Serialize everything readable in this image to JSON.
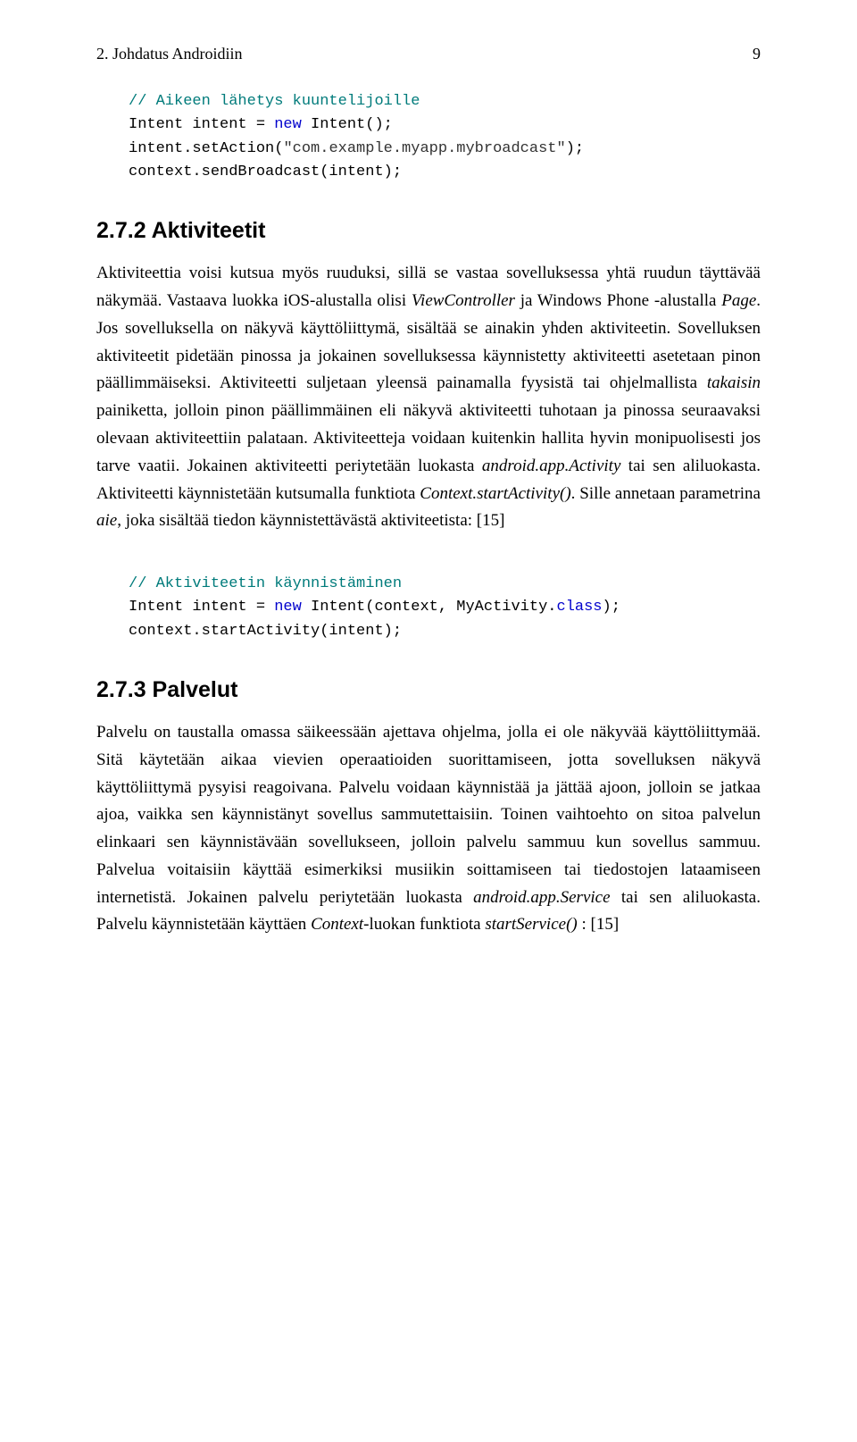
{
  "header": {
    "chapter": "2. Johdatus Androidiin",
    "page_no": "9"
  },
  "code1": {
    "comment": "// Aikeen lähetys kuuntelijoille",
    "l1a": "Intent intent = ",
    "l1b": "new",
    "l1c": " Intent();",
    "l2a": "intent.setAction(",
    "l2b": "\"com.example.myapp.mybroadcast\"",
    "l2c": ");",
    "l3": "context.sendBroadcast(intent);"
  },
  "section272": {
    "number_title": "2.7.2   Aktiviteetit",
    "para": "Aktiviteettia voisi kutsua myös ruuduksi, sillä se vastaa sovelluksessa yhtä ruudun täyttävää näkymää. Vastaava luokka iOS-alustalla olisi ViewController ja Windows Phone -alustalla Page. Jos sovelluksella on näkyvä käyttöliittymä, sisältää se ainakin yhden aktiviteetin. Sovelluksen aktiviteetit pidetään pinossa ja jokainen sovelluksessa käynnistetty aktiviteetti asetetaan pinon päällimmäiseksi. Aktiviteetti suljetaan yleensä painamalla fyysistä tai ohjelmallista takaisin painiketta, jolloin pinon päällimmäinen eli näkyvä aktiviteetti tuhotaan ja pinossa seuraavaksi olevaan aktiviteettiin palataan. Aktiviteetteja voidaan kuitenkin hallita hyvin monipuolisesti jos tarve vaatii. Jokainen aktiviteetti periytetään luokasta android.app.Activity tai sen aliluokasta. Aktiviteetti käynnistetään kutsumalla funktiota Context.startActivity(). Sille annetaan parametrina aie, joka sisältää tiedon käynnistettävästä aktiviteetista: [15]"
  },
  "code2": {
    "comment": "// Aktiviteetin käynnistäminen",
    "l1a": "Intent intent = ",
    "l1b": "new",
    "l1c": " Intent(context, MyActivity.",
    "l1d": "class",
    "l1e": ");",
    "l2": "context.startActivity(intent);"
  },
  "section273": {
    "number_title": "2.7.3   Palvelut",
    "para": "Palvelu on taustalla omassa säikeessään ajettava ohjelma, jolla ei ole näkyvää käyttöliittymää. Sitä käytetään aikaa vievien operaatioiden suorittamiseen, jotta sovelluksen näkyvä käyttöliittymä pysyisi reagoivana. Palvelu voidaan käynnistää ja jättää ajoon, jolloin se jatkaa ajoa, vaikka sen käynnistänyt sovellus sammutettaisiin. Toinen vaihtoehto on sitoa palvelun elinkaari sen käynnistävään sovellukseen, jolloin palvelu sammuu kun sovellus sammuu. Palvelua voitaisiin käyttää esimerkiksi musiikin soittamiseen tai tiedostojen lataamiseen internetistä. Jokainen palvelu periytetään luokasta android.app.Service tai sen aliluokasta. Palvelu käynnistetään käyttäen Context-luokan funktiota startService() : [15]"
  }
}
